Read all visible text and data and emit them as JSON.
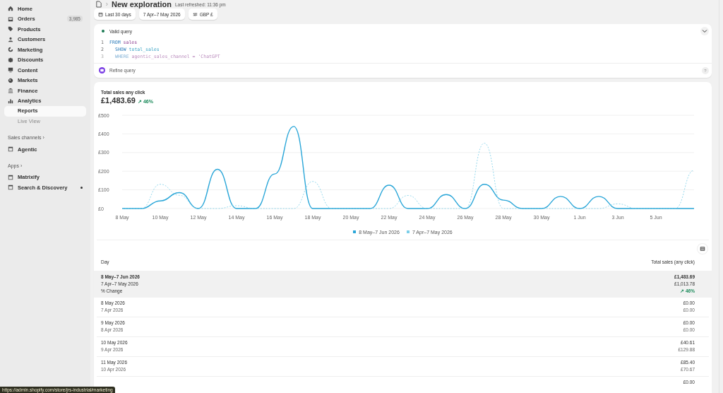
{
  "sidebar": {
    "items": [
      {
        "label": "Home",
        "selected": false
      },
      {
        "label": "Orders",
        "badge": "3,985",
        "selected": false
      },
      {
        "label": "Products",
        "selected": false
      },
      {
        "label": "Customers",
        "selected": false
      },
      {
        "label": "Marketing",
        "selected": false
      },
      {
        "label": "Discounts",
        "selected": false
      },
      {
        "label": "Content",
        "selected": false
      },
      {
        "label": "Markets",
        "selected": false
      },
      {
        "label": "Finance",
        "selected": false
      },
      {
        "label": "Analytics",
        "selected": false,
        "expanded": true,
        "children": [
          {
            "label": "Reports",
            "selected": true
          },
          {
            "label": "Live View",
            "selected": false
          }
        ]
      }
    ],
    "sections": [
      {
        "title": "Sales channels",
        "arrow": "›",
        "items": [
          {
            "label": "Agentic",
            "dot": false
          }
        ]
      },
      {
        "title": "Apps",
        "arrow": "›",
        "items": [
          {
            "label": "Matrixify",
            "dot": false
          },
          {
            "label": "Search & Discovery",
            "dot": true
          }
        ]
      }
    ]
  },
  "header": {
    "title": "New exploration",
    "refreshed": "Last refreshed: 11:36 pm"
  },
  "filters": [
    {
      "kind": "calendar",
      "label": "Last 30 days"
    },
    {
      "kind": "plain",
      "label": "7 Apr–7 May 2026"
    },
    {
      "kind": "currency",
      "label": "GBP £"
    }
  ],
  "query": {
    "status": "Valid query",
    "valid": true,
    "lines": [
      {
        "num": "1",
        "keyword": "FROM",
        "rest": " sales",
        "indent": false,
        "faded": false
      },
      {
        "num": "2",
        "keyword": "SHOW",
        "rest": " total_sales",
        "indent": true,
        "faded": false
      },
      {
        "num": "3",
        "keyword": "WHERE",
        "rest": " agentic_sales_channel = 'ChatGPT",
        "indent": true,
        "faded": true
      }
    ],
    "refine": "Refine query",
    "help": "?"
  },
  "metric": {
    "title": "Total sales any click",
    "value": "£1,483.69",
    "change": "↗ 46%",
    "change_up": true,
    "chart_data": {
      "type": "line",
      "grid": true,
      "categories": [
        "8 May",
        null,
        "10 May",
        null,
        "12 May",
        null,
        "14 May",
        null,
        "16 May",
        null,
        "18 May",
        null,
        "20 May",
        null,
        "22 May",
        null,
        "24 May",
        null,
        "26 May",
        null,
        "28 May",
        null,
        "30 May",
        null,
        "1 Jun",
        null,
        "3 Jun",
        null,
        "5 Jun",
        null,
        null
      ],
      "yticks": [
        {
          "value": 0,
          "label": "£0"
        },
        {
          "value": 100,
          "label": "£100"
        },
        {
          "value": 200,
          "label": "£200"
        },
        {
          "value": 300,
          "label": "£300"
        },
        {
          "value": 400,
          "label": "£400"
        },
        {
          "value": 500,
          "label": "£500"
        }
      ],
      "ylim": [
        0,
        500
      ],
      "series": [
        {
          "name": "8 May–7 Jun 2026",
          "color": "#2aa6d8",
          "line_style": "solid",
          "values": [
            0,
            0,
            41,
            85,
            0,
            210,
            0,
            0,
            185,
            440,
            0,
            0,
            0,
            0,
            125,
            0,
            0,
            75,
            0,
            130,
            45,
            0,
            0,
            65,
            0,
            65,
            0,
            0,
            0,
            0,
            0
          ]
        },
        {
          "name": "7 Apr–7 May 2026",
          "color": "#7ccfe9",
          "line_style": "dashed",
          "values": [
            0,
            0,
            130,
            71,
            0,
            0,
            15,
            0,
            0,
            0,
            145,
            0,
            0,
            0,
            0,
            70,
            0,
            0,
            0,
            350,
            0,
            0,
            0,
            0,
            0,
            0,
            25,
            0,
            0,
            0,
            205
          ]
        }
      ]
    }
  },
  "table": {
    "columns": [
      "Day",
      "Total sales (any click)"
    ],
    "summary": [
      {
        "label": "8 May–7 Jun 2026",
        "value": "£1,483.69",
        "kind": "current"
      },
      {
        "label": "7 Apr–7 May 2026",
        "value": "£1,013.78",
        "kind": "previous"
      },
      {
        "label": "% Change",
        "value": "↗ 46%",
        "kind": "change"
      }
    ],
    "rows": [
      {
        "day": "8 May 2026",
        "prev_day": "7 Apr 2026",
        "value": "£0.00",
        "prev_value": "£0.00"
      },
      {
        "day": "9 May 2026",
        "prev_day": "8 Apr 2026",
        "value": "£0.00",
        "prev_value": "£0.00"
      },
      {
        "day": "10 May 2026",
        "prev_day": "9 Apr 2026",
        "value": "£40.61",
        "prev_value": "£129.88"
      },
      {
        "day": "11 May 2026",
        "prev_day": "10 Apr 2026",
        "value": "£85.40",
        "prev_value": "£70.67"
      },
      {
        "value": "£0.00"
      }
    ]
  },
  "link_preview": "https://admin.shopify.com/store/jrs-industrial/marketing"
}
